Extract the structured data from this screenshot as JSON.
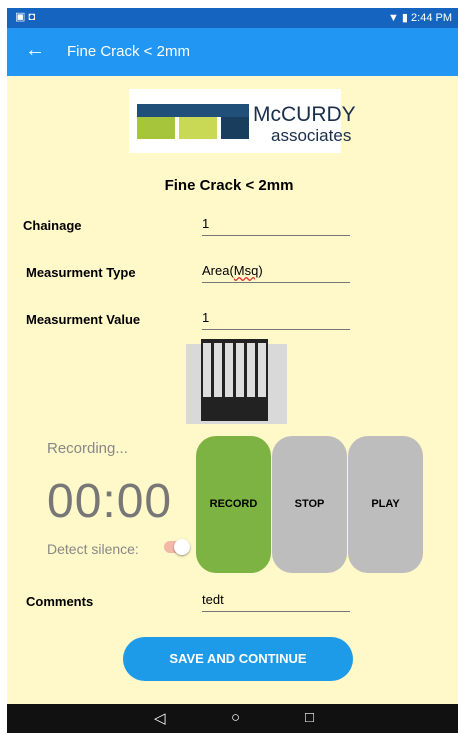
{
  "status_bar": {
    "time": "2:44 PM",
    "left_icons": "▣ ◘",
    "right_icons": "▼ ▮"
  },
  "app_bar": {
    "back_glyph": "←",
    "title": "Fine Crack < 2mm"
  },
  "logo": {
    "name": "McCURDY",
    "sub": "associates"
  },
  "form": {
    "heading": "Fine Crack < 2mm",
    "chainage_label": "Chainage",
    "chainage_value": "1",
    "measurement_type_label": "Measurment Type",
    "measurement_type_value_prefix": "Area(",
    "measurement_type_value_underlined": "Msq",
    "measurement_type_value_suffix": ")",
    "measurement_value_label": "Measurment Value",
    "measurement_value": "1"
  },
  "recorder": {
    "status": "Recording...",
    "timer": "00:00",
    "detect_silence_label": "Detect silence:",
    "detect_silence_on": true,
    "record_label": "RECORD",
    "stop_label": "STOP",
    "play_label": "PLAY",
    "record_color": "#7cb342",
    "idle_color": "#bdbdbd"
  },
  "comments": {
    "label": "Comments",
    "value": "tedt"
  },
  "save_button": {
    "label": "SAVE AND CONTINUE",
    "color": "#1e9be8"
  },
  "nav": {
    "back": "◁",
    "home": "○",
    "recents": "□"
  }
}
